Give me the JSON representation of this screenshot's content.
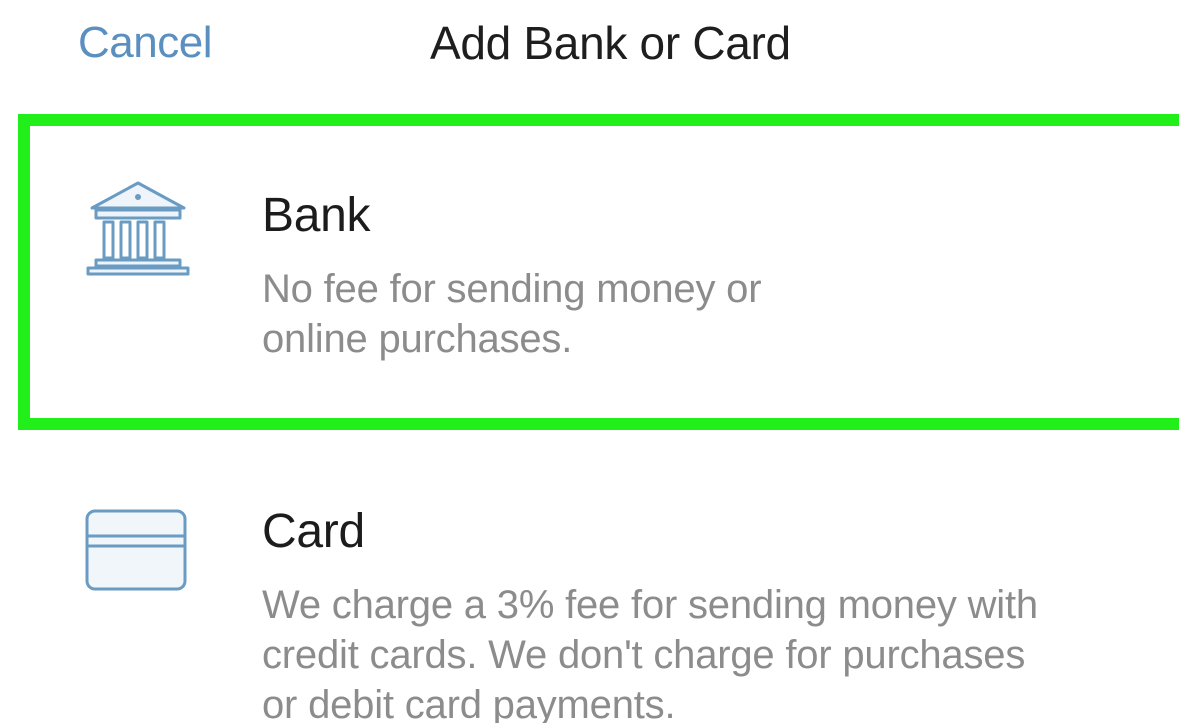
{
  "header": {
    "cancel_label": "Cancel",
    "title": "Add Bank or Card"
  },
  "options": [
    {
      "icon": "bank-icon",
      "title": "Bank",
      "description_line1": "No fee for sending money or",
      "description_line2": "online purchases.",
      "highlighted": true
    },
    {
      "icon": "credit-card-icon",
      "title": "Card",
      "description_line1": "We charge a 3% fee for sending money with",
      "description_line2": "credit cards. We don't charge for purchases",
      "description_line3": "or debit card payments.",
      "highlighted": false
    }
  ],
  "colors": {
    "accent": "#5a8fbf",
    "highlight": "#22ee1a",
    "icon_stroke": "#6a9bc3",
    "title_text": "#1c1c1c",
    "secondary_text": "#8c8c8c"
  }
}
